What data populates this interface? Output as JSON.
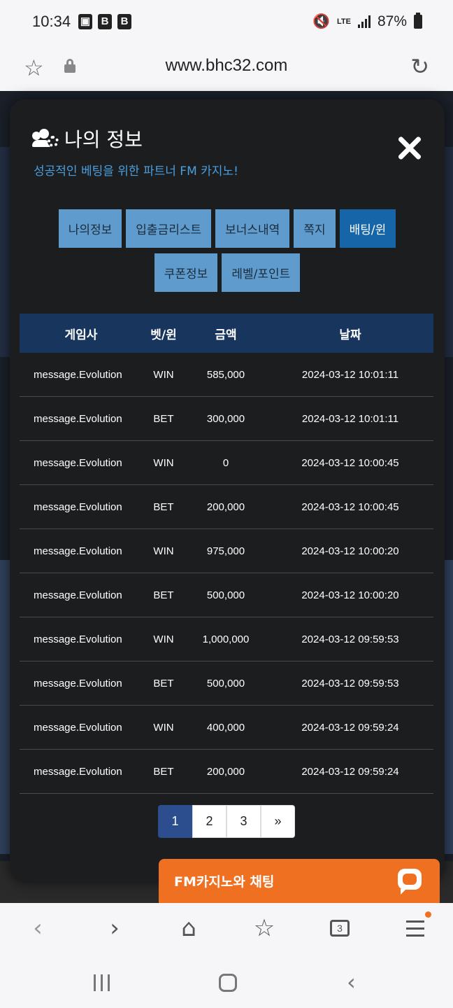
{
  "status_bar": {
    "time": "10:34",
    "battery": "87%",
    "network": "LTE",
    "left_icons": [
      "image-icon",
      "b-app-icon",
      "b-app-icon"
    ],
    "right_icons": [
      "mute-icon",
      "lte-icon",
      "signal-icon",
      "battery-icon"
    ]
  },
  "browser": {
    "url": "www.bhc32.com",
    "tab_count": "3"
  },
  "modal": {
    "title": "나의 정보",
    "subtitle": "성공적인 베팅을 위한 파트너 FM 카지노!",
    "tabs": [
      {
        "label": "나의정보",
        "active": false
      },
      {
        "label": "입출금리스트",
        "active": false
      },
      {
        "label": "보너스내역",
        "active": false
      },
      {
        "label": "쪽지",
        "active": false
      },
      {
        "label": "배팅/윈",
        "active": true
      },
      {
        "label": "쿠폰정보",
        "active": false
      },
      {
        "label": "레벨/포인트",
        "active": false
      }
    ],
    "table": {
      "headers": [
        "게임사",
        "벳/윈",
        "금액",
        "날짜"
      ],
      "rows": [
        [
          "message.Evolution",
          "WIN",
          "585,000",
          "2024-03-12 10:01:11"
        ],
        [
          "message.Evolution",
          "BET",
          "300,000",
          "2024-03-12 10:01:11"
        ],
        [
          "message.Evolution",
          "WIN",
          "0",
          "2024-03-12 10:00:45"
        ],
        [
          "message.Evolution",
          "BET",
          "200,000",
          "2024-03-12 10:00:45"
        ],
        [
          "message.Evolution",
          "WIN",
          "975,000",
          "2024-03-12 10:00:20"
        ],
        [
          "message.Evolution",
          "BET",
          "500,000",
          "2024-03-12 10:00:20"
        ],
        [
          "message.Evolution",
          "WIN",
          "1,000,000",
          "2024-03-12 09:59:53"
        ],
        [
          "message.Evolution",
          "BET",
          "500,000",
          "2024-03-12 09:59:53"
        ],
        [
          "message.Evolution",
          "WIN",
          "400,000",
          "2024-03-12 09:59:24"
        ],
        [
          "message.Evolution",
          "BET",
          "200,000",
          "2024-03-12 09:59:24"
        ]
      ]
    },
    "pagination": {
      "pages": [
        "1",
        "2",
        "3",
        "»"
      ],
      "current": "1"
    }
  },
  "chat": {
    "label": "FM카지노와 채팅"
  },
  "colors": {
    "accent_blue": "#1565a8",
    "tab_blue": "#5f9ccd",
    "header_navy": "#17355d",
    "chat_orange": "#f07022",
    "subtitle_blue": "#4a9fde"
  }
}
